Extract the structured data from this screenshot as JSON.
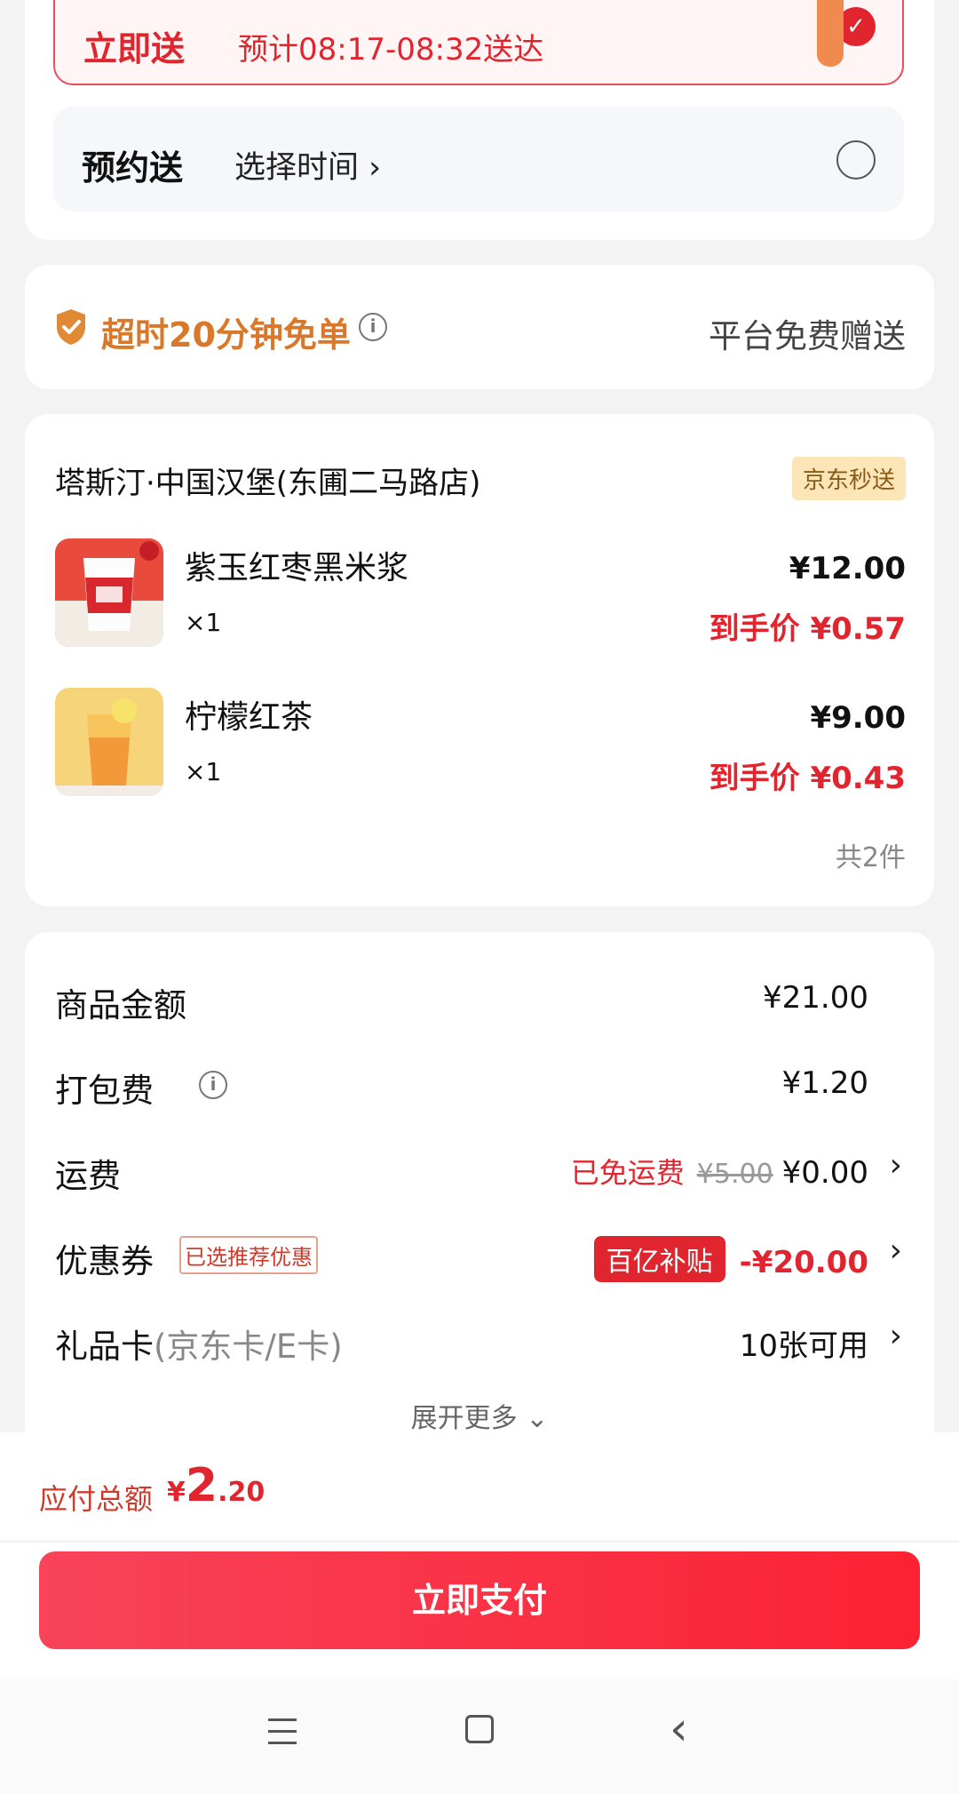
{
  "delivery": {
    "now_label": "立即送",
    "now_time": "预计08:17-08:32送达",
    "later_label": "预约送",
    "later_choose": "选择时间 ›"
  },
  "guarantee": {
    "title": "超时20分钟免单",
    "right_text": "平台免费赠送"
  },
  "store": {
    "name": "塔斯汀·中国汉堡(东圃二马路店)",
    "tag": "京东秒送",
    "items": [
      {
        "name": "紫玉红枣黑米浆",
        "qty": "×1",
        "price": "¥12.00",
        "final_label": "到手价",
        "final_price": "¥0.57"
      },
      {
        "name": "柠檬红茶",
        "qty": "×1",
        "price": "¥9.00",
        "final_label": "到手价",
        "final_price": "¥0.43"
      }
    ],
    "total_count": "共2件"
  },
  "cost": {
    "goods_label": "商品金额",
    "goods_value": "¥21.00",
    "packing_label": "打包费",
    "packing_value": "¥1.20",
    "shipping_label": "运费",
    "shipping_free": "已免运费",
    "shipping_original": "¥5.00",
    "shipping_value": "¥0.00",
    "coupon_label": "优惠券",
    "coupon_badge": "已选推荐优惠",
    "coupon_subsidy": "百亿补贴",
    "coupon_value": "-¥20.00",
    "giftcard_label": "礼品卡",
    "giftcard_sub": "(京东卡/E卡)",
    "giftcard_value": "10张可用",
    "expand": "展开更多 ⌄"
  },
  "bottom": {
    "due_label": "应付总额",
    "currency": "¥",
    "due_int": "2",
    "due_dec": ".20",
    "pay_button": "立即支付"
  },
  "colors": {
    "accent_red": "#e0252f",
    "guarantee_orange": "#d9782a"
  }
}
